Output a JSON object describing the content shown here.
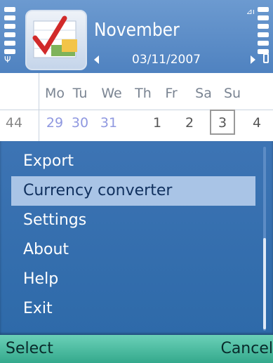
{
  "header": {
    "month": "November",
    "date": "03/11/2007",
    "app_icon": "calendar-check-icon"
  },
  "calendar": {
    "day_headers": [
      "Mo",
      "Tu",
      "We",
      "Th",
      "Fr",
      "Sa",
      "Su"
    ],
    "week_number": "44",
    "days": [
      "29",
      "30",
      "31",
      "1",
      "2",
      "3",
      "4"
    ],
    "today_index": 5
  },
  "menu": {
    "items": [
      "Export",
      "Currency converter",
      "Settings",
      "About",
      "Help",
      "Exit"
    ],
    "selected_index": 1
  },
  "softkeys": {
    "left": "Select",
    "right": "Cancel"
  }
}
